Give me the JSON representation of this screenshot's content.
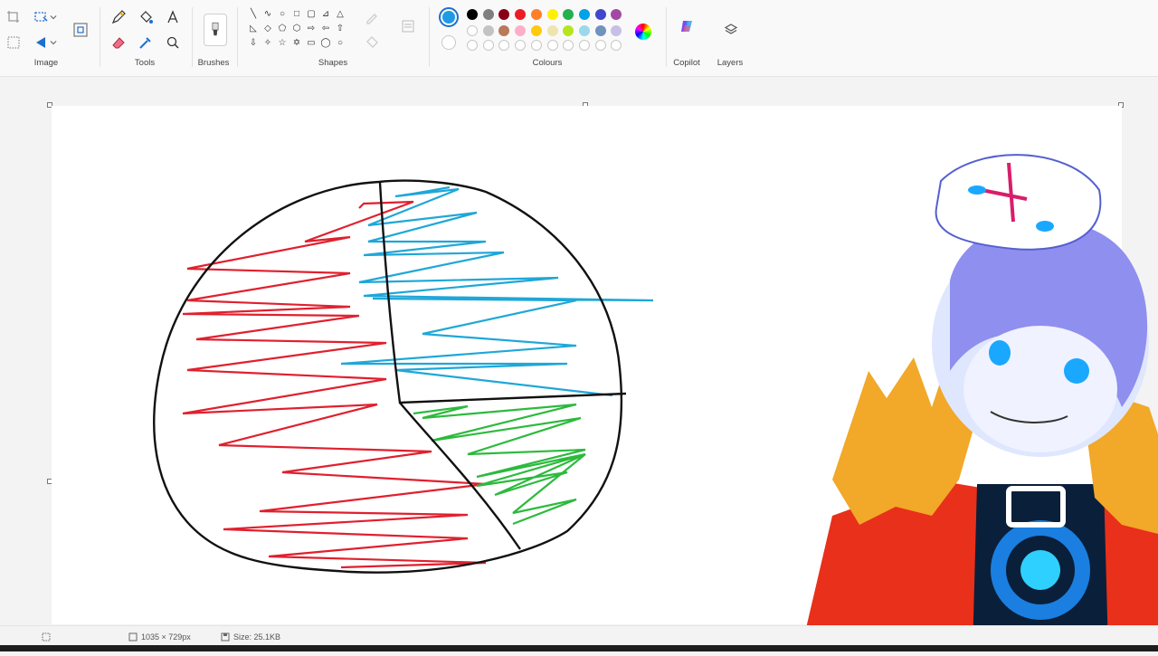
{
  "ribbon": {
    "groups": {
      "image": "Image",
      "tools": "Tools",
      "brushes": "Brushes",
      "shapes": "Shapes",
      "colours": "Colours",
      "copilot": "Copilot",
      "layers": "Layers"
    }
  },
  "colours": {
    "selected": "#1e9be4",
    "row1": [
      "#000000",
      "#7f7f7f",
      "#880015",
      "#ed1c24",
      "#ff7f27",
      "#fff200",
      "#22b14c",
      "#00a2e8",
      "#3f48cc",
      "#a349a4"
    ],
    "row2": [
      "#ffffff",
      "#c3c3c3",
      "#b97a57",
      "#ffaec9",
      "#ffc90e",
      "#efe4b0",
      "#b5e61d",
      "#99d9ea",
      "#7092be",
      "#c8bfe7"
    ]
  },
  "icons": {
    "image": [
      "crop-icon",
      "select-icon",
      "resize-icon",
      "rotate-icon",
      "select-dropdown-icon",
      "flip-dropdown-icon"
    ],
    "tools": [
      "pencil-icon",
      "fill-icon",
      "text-icon",
      "eraser-icon",
      "color-picker-icon",
      "magnifier-icon"
    ],
    "copilot": "copilot-icon",
    "layers": "layers-icon"
  },
  "statusbar": {
    "canvas_size": "1035 × 729px",
    "file_size": "Size: 25.1KB"
  },
  "drawing": {
    "pie_segments": [
      {
        "color": "#e0202e",
        "label": "red"
      },
      {
        "color": "#1fa7d8",
        "label": "blue"
      },
      {
        "color": "#2cba3c",
        "label": "green"
      }
    ]
  }
}
